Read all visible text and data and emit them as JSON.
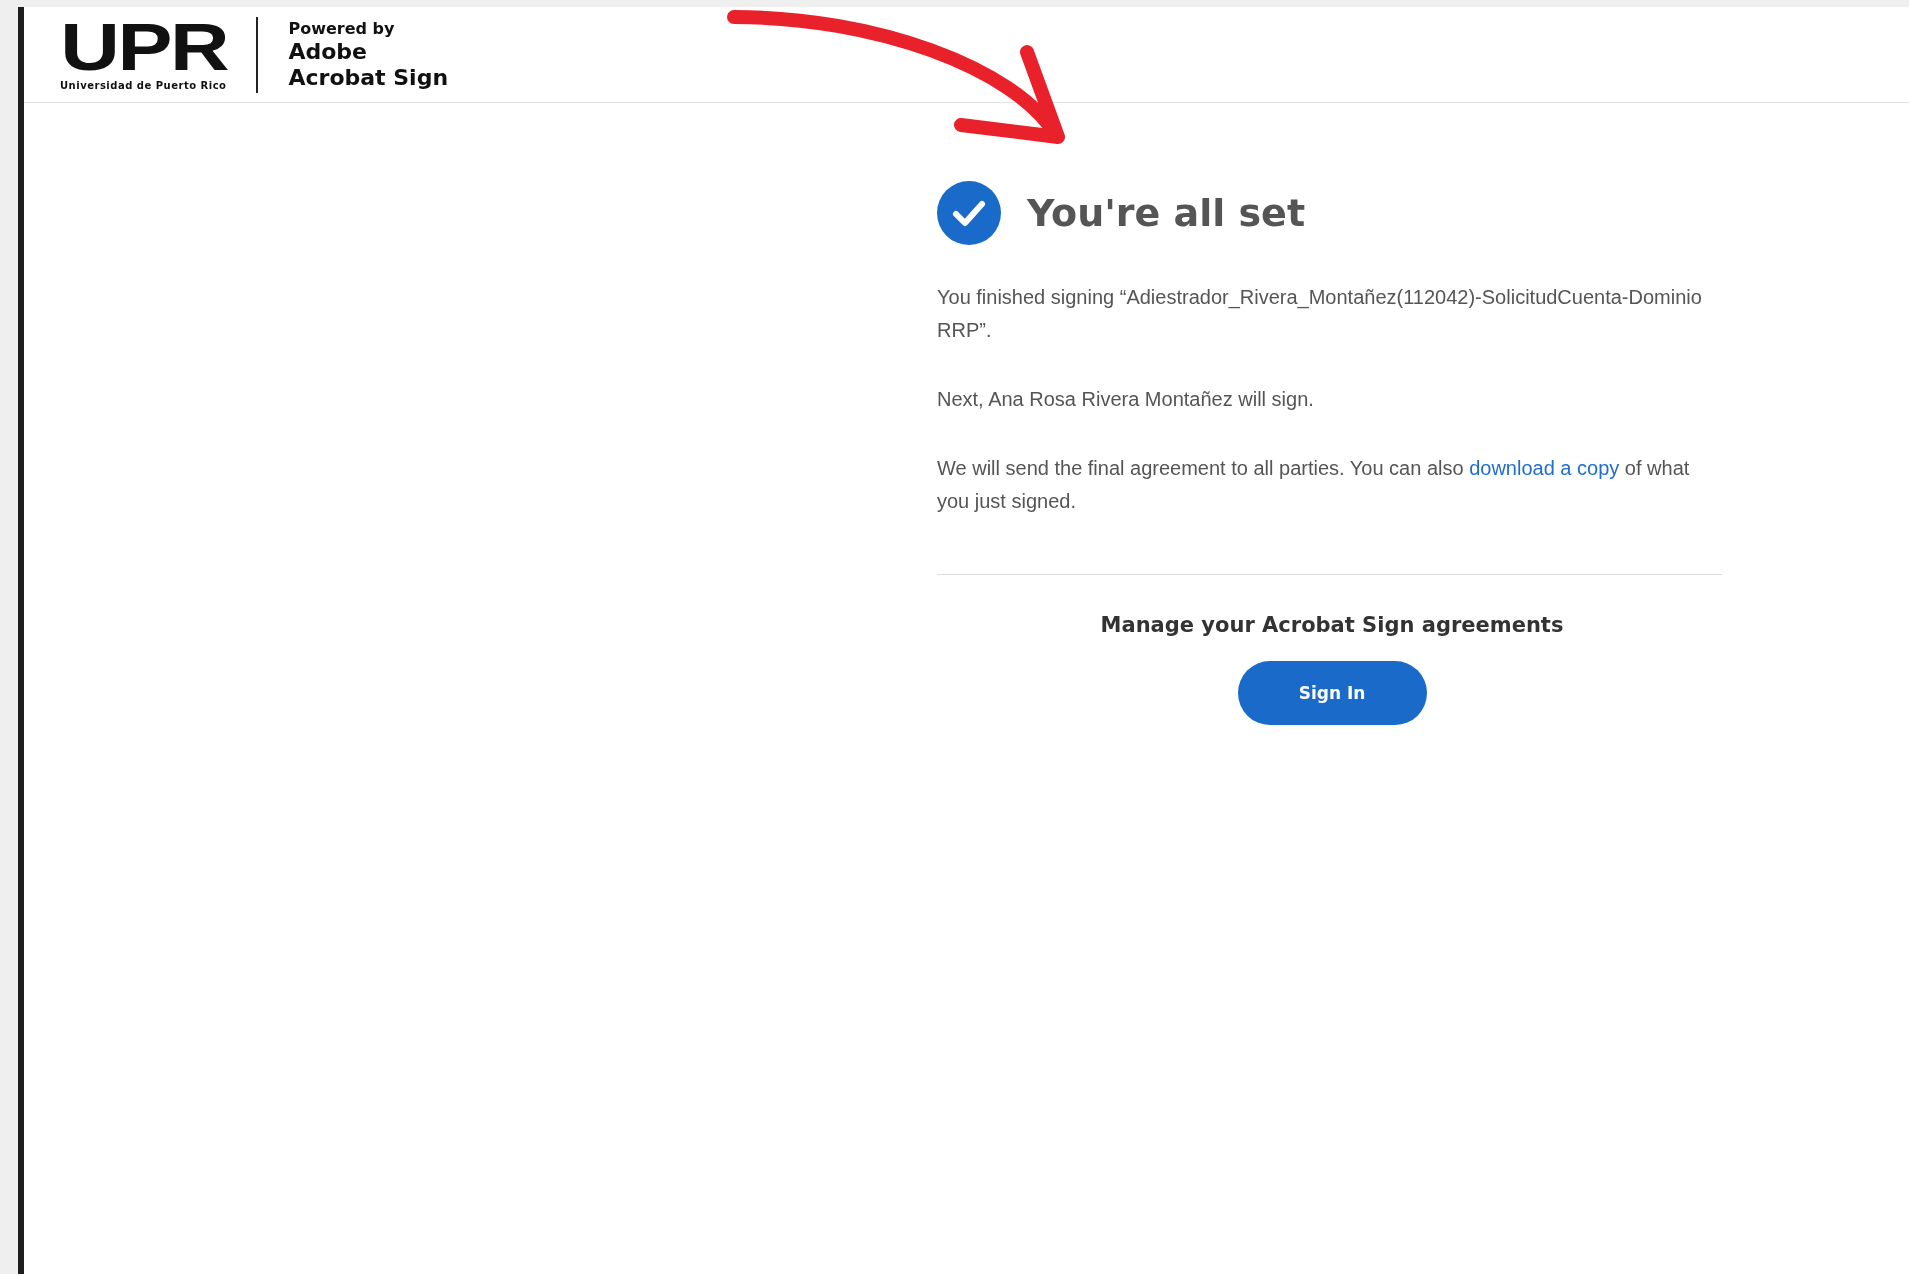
{
  "header": {
    "logo": {
      "letters": "UPR",
      "subtitle": "Universidad de Puerto Rico"
    },
    "powered_by": "Powered by",
    "product": [
      "Adobe",
      "Acrobat Sign"
    ]
  },
  "confirmation": {
    "title": "You're all set",
    "paragraphs": [
      {
        "before": "You finished signing “Adiestrador_Rivera_Montañez(112042)-SolicitudCuenta-Dominio RRP”."
      },
      {
        "before": "Next, Ana Rosa Rivera Montañez will sign."
      },
      {
        "before": "We will send the final agreement to all parties. You can also ",
        "link": "download a copy",
        "after": " of what you just signed."
      }
    ]
  },
  "manage": {
    "heading": "Manage your Acrobat Sign agreements",
    "button": "Sign In"
  }
}
